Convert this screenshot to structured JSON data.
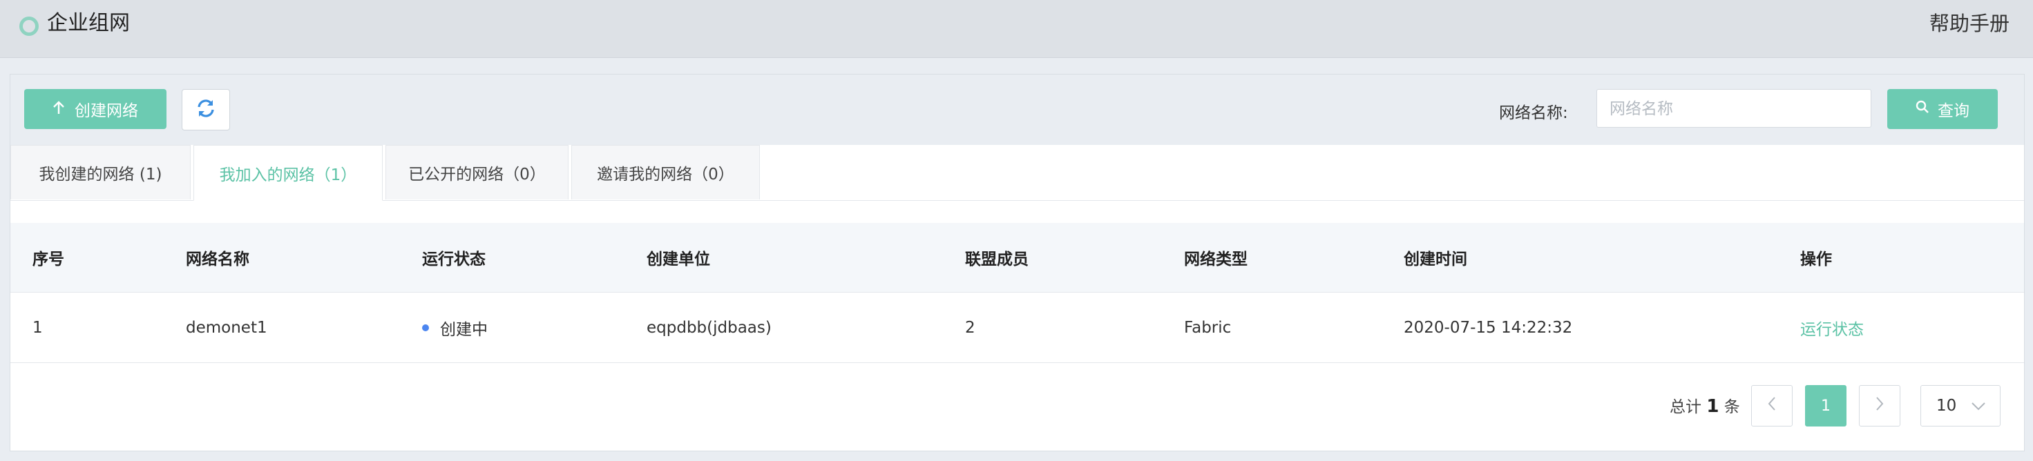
{
  "header": {
    "title": "企业组网",
    "help_label": "帮助手册"
  },
  "toolbar": {
    "create_label": "创建网络",
    "search_label": "网络名称:",
    "search_placeholder": "网络名称",
    "search_value": "",
    "query_label": "查询"
  },
  "tabs": [
    {
      "label": "我创建的网络 (1)",
      "active": false
    },
    {
      "label": "我加入的网络（1）",
      "active": true
    },
    {
      "label": "已公开的网络（0）",
      "active": false
    },
    {
      "label": "邀请我的网络（0）",
      "active": false
    }
  ],
  "table": {
    "columns": [
      "序号",
      "网络名称",
      "运行状态",
      "创建单位",
      "联盟成员",
      "网络类型",
      "创建时间",
      "操作"
    ],
    "rows": [
      {
        "index": "1",
        "name": "demonet1",
        "status": "创建中",
        "org": "eqpdbb(jdbaas)",
        "members": "2",
        "type": "Fabric",
        "created": "2020-07-15 14:22:32",
        "action": "运行状态"
      }
    ]
  },
  "pagination": {
    "total_prefix": "总计",
    "total": "1",
    "total_suffix": "条",
    "current_page": "1",
    "page_size": "10"
  },
  "colors": {
    "accent": "#6ccbb2",
    "status_dot": "#4c86f0",
    "link": "#5bc2a5"
  },
  "icons": [
    "upload-arrow-icon",
    "refresh-icon",
    "search-icon",
    "chevron-left-icon",
    "chevron-right-icon",
    "chevron-down-icon"
  ]
}
